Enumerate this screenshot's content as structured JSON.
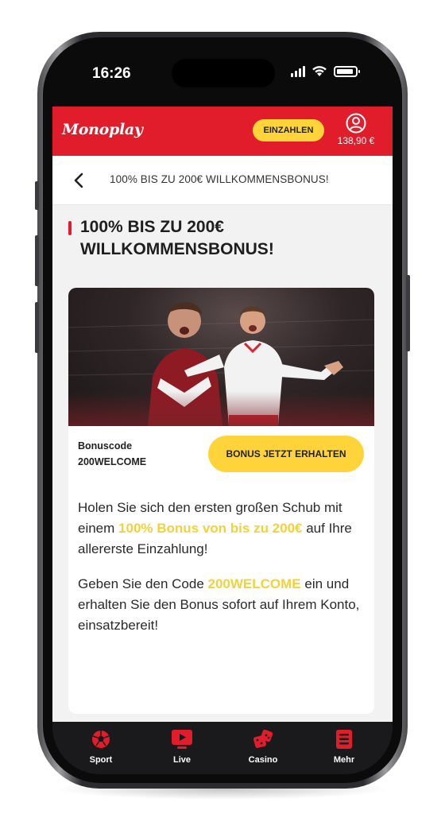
{
  "status_bar": {
    "time": "16:26"
  },
  "header": {
    "logo": "Monoplay",
    "deposit_label": "EINZAHLEN",
    "balance": "138,90 €"
  },
  "breadcrumb": {
    "title": "100% BIS ZU 200€ WILLKOMMENSBONUS!"
  },
  "page": {
    "title_line1": "100% BIS ZU 200€",
    "title_line2": "WILLKOMMENSBONUS!"
  },
  "promo": {
    "bonus_code_label": "Bonuscode",
    "bonus_code": "200WELCOME",
    "cta_label": "BONUS JETZT ERHALTEN",
    "p1_before": "Holen Sie sich den ersten großen Schub mit einem ",
    "p1_highlight": "100% Bonus von bis zu 200€",
    "p1_after": " auf Ihre allererste Einzahlung!",
    "p2_before": "Geben Sie den Code ",
    "p2_highlight": "200WELCOME",
    "p2_after": " ein und erhalten Sie den Bonus sofort auf Ihrem Konto, einsatzbereit!"
  },
  "tabbar": {
    "items": [
      {
        "label": "Sport",
        "icon": "soccer-ball-icon"
      },
      {
        "label": "Live",
        "icon": "live-play-icon"
      },
      {
        "label": "Casino",
        "icon": "dice-icon"
      },
      {
        "label": "Mehr",
        "icon": "more-menu-icon"
      }
    ]
  },
  "colors": {
    "brand_red": "#e11d2b",
    "accent_yellow": "#ffd43b",
    "highlight_yellow": "#f2d23a"
  }
}
